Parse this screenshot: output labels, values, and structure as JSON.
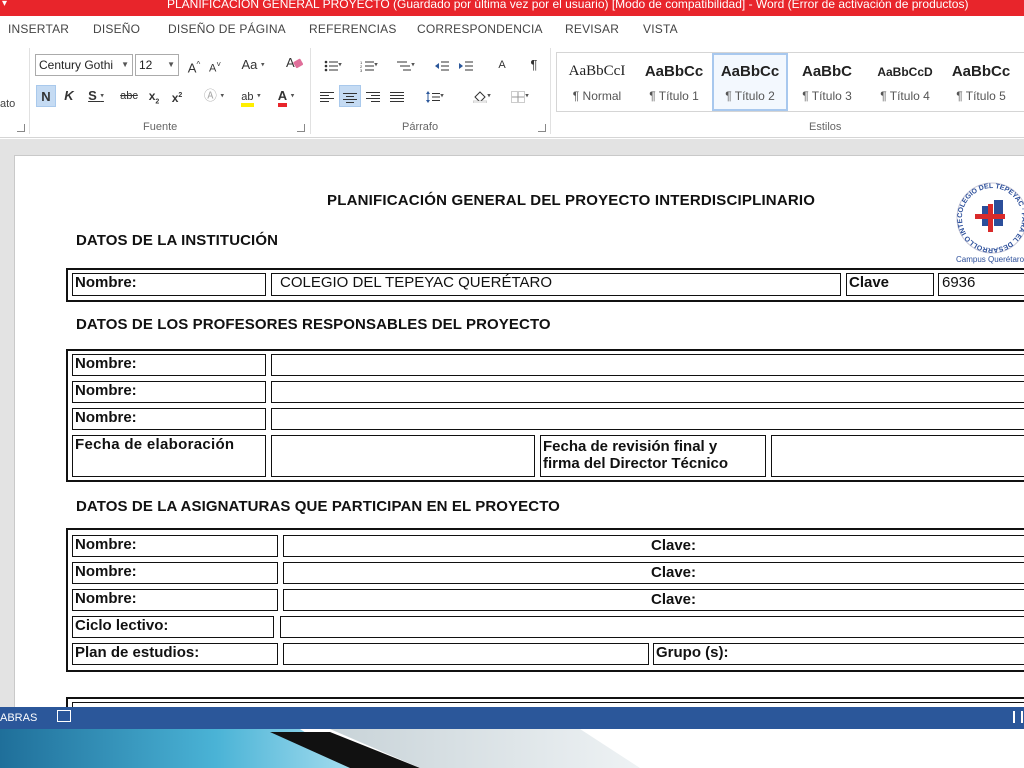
{
  "window": {
    "title": "PLANIFICACIÓN GENERAL PROYECTO (Guardado por última vez por el usuario) [Modo de compatibilidad] -  Word (Error de activación de productos)"
  },
  "tabs": [
    "INSERTAR",
    "DISEÑO",
    "DISEÑO DE PÁGINA",
    "REFERENCIAS",
    "CORRESPONDENCIA",
    "REVISAR",
    "VISTA"
  ],
  "ribbon": {
    "cutoff_label": "ato",
    "font": {
      "name": "Century Gothi",
      "size": "12",
      "group_label": "Fuente"
    },
    "paragraph": {
      "group_label": "Párrafo"
    },
    "styles": {
      "group_label": "Estilos",
      "items": [
        {
          "sample": "AaBbCcI",
          "name": "¶ Normal"
        },
        {
          "sample": "AaBbCc",
          "name": "¶ Título 1"
        },
        {
          "sample": "AaBbCc",
          "name": "¶ Título 2"
        },
        {
          "sample": "AaBbC",
          "name": "¶ Título 3"
        },
        {
          "sample": "AaBbCcD",
          "name": "¶ Título 4"
        },
        {
          "sample": "AaBbCc",
          "name": "¶ Título 5"
        }
      ],
      "selected_index": 2
    }
  },
  "document": {
    "title": "PLANIFICACIÓN GENERAL DEL PROYECTO INTERDISCIPLINARIO",
    "logo": {
      "ring_text": "COLEGIO DEL TEPEYAC · PARA EL DESARROLLO INTEGRAL",
      "caption": "Campus Querétaro"
    },
    "institution": {
      "heading": "DATOS DE LA INSTITUCIÓN",
      "name_label": "Nombre:",
      "name_value": "COLEGIO DEL TEPEYAC QUERÉTARO",
      "key_label": "Clave",
      "key_value": "6936"
    },
    "teachers": {
      "heading": "DATOS DE LOS PROFESORES RESPONSABLES DEL PROYECTO",
      "name_label": "Nombre:",
      "date_label": "Fecha de elaboración",
      "review_label_1": "Fecha de revisión final y",
      "review_label_2": "firma del Director Técnico"
    },
    "subjects": {
      "heading": "DATOS DE LA ASIGNATURAS QUE PARTICIPAN EN EL PROYECTO",
      "name_label": "Nombre:",
      "key_label": "Clave:",
      "cycle_label": "Ciclo lectivo:",
      "plan_label": "Plan de estudios:",
      "group_label": "Grupo (s):"
    }
  },
  "statusbar": {
    "words": "ABRAS"
  },
  "colors": {
    "titlebar": "#e8252b",
    "statusbar": "#2b579a",
    "accent_blue": "#2b579a",
    "selected_style": "#a8c8ee"
  }
}
